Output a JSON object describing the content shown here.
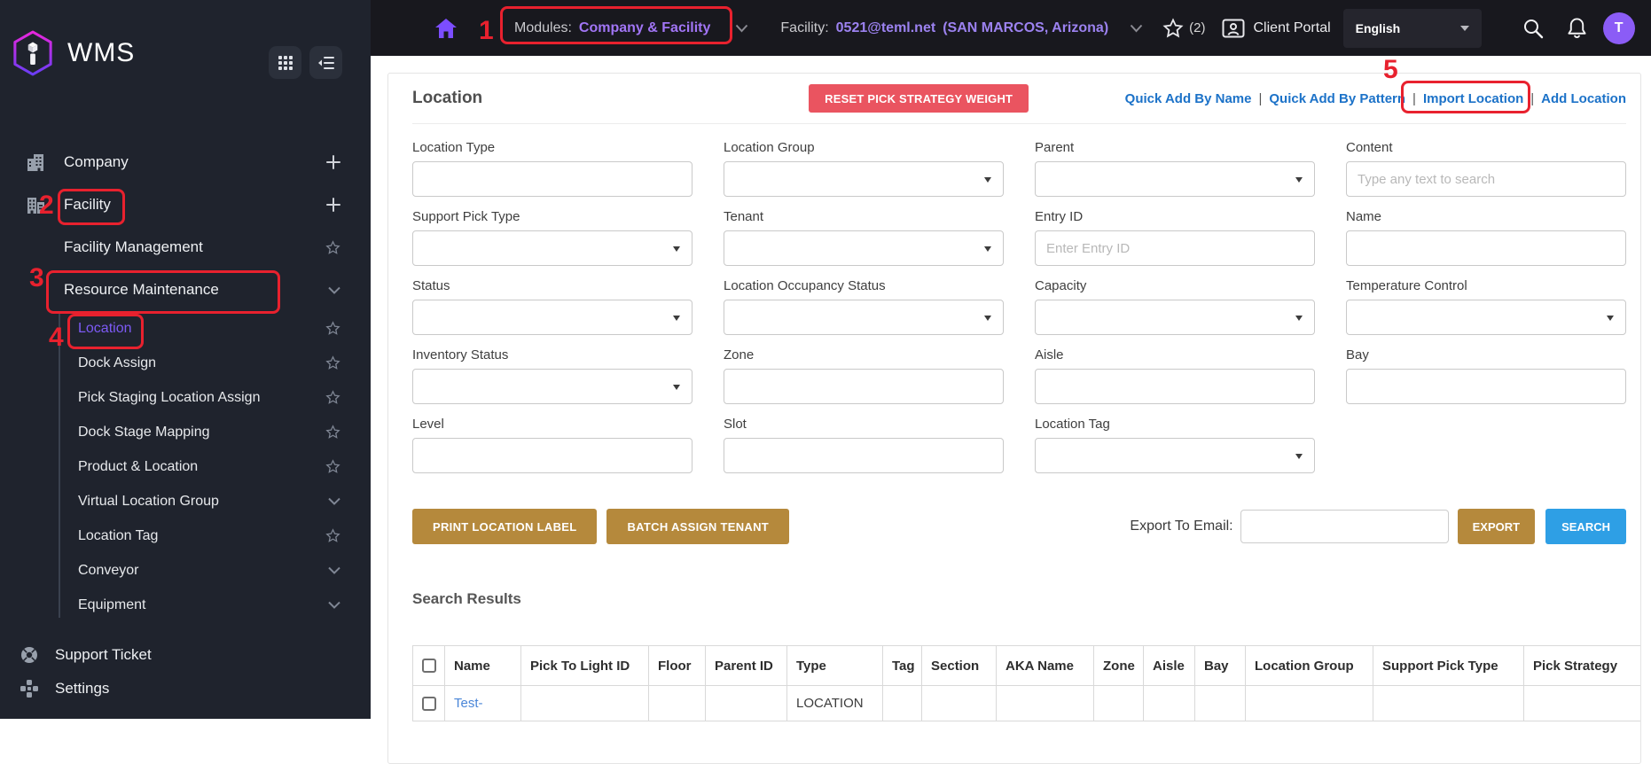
{
  "topbar": {
    "modules_label": "Modules:",
    "modules_value": "Company & Facility",
    "facility_label": "Facility:",
    "facility_value": "0521@teml.net",
    "facility_region": "(SAN MARCOS, Arizona)",
    "favorites_count": "(2)",
    "client_portal_label": "Client Portal",
    "language_value": "English",
    "avatar_initial": "T"
  },
  "sidebar": {
    "brand": "WMS",
    "items": [
      {
        "label": "Company"
      },
      {
        "label": "Facility"
      },
      {
        "label": "Facility Management"
      },
      {
        "label": "Resource Maintenance"
      }
    ],
    "submenu": [
      {
        "label": "Location"
      },
      {
        "label": "Dock Assign"
      },
      {
        "label": "Pick Staging Location Assign"
      },
      {
        "label": "Dock Stage Mapping"
      },
      {
        "label": "Product & Location"
      },
      {
        "label": "Virtual Location Group"
      },
      {
        "label": "Location Tag"
      },
      {
        "label": "Conveyor"
      },
      {
        "label": "Equipment"
      }
    ],
    "footer": [
      {
        "label": "Support Ticket"
      },
      {
        "label": "Settings"
      }
    ]
  },
  "page": {
    "title": "Location",
    "reset_button": "RESET PICK STRATEGY WEIGHT",
    "link_separator": "|",
    "links": [
      {
        "label": "Quick Add By Name"
      },
      {
        "label": "Quick Add By Pattern"
      },
      {
        "label": "Import Location"
      },
      {
        "label": "Add Location"
      }
    ]
  },
  "filters": {
    "fields": [
      {
        "label": "Location Type",
        "placeholder": ""
      },
      {
        "label": "Location Group"
      },
      {
        "label": "Parent"
      },
      {
        "label": "Content",
        "placeholder": "Type any text to search"
      },
      {
        "label": "Support Pick Type"
      },
      {
        "label": "Tenant"
      },
      {
        "label": "Entry ID",
        "placeholder": "Enter Entry ID"
      },
      {
        "label": "Name",
        "placeholder": ""
      },
      {
        "label": "Status"
      },
      {
        "label": "Location Occupancy Status"
      },
      {
        "label": "Capacity"
      },
      {
        "label": "Temperature Control"
      },
      {
        "label": "Inventory Status"
      },
      {
        "label": "Zone",
        "placeholder": ""
      },
      {
        "label": "Aisle",
        "placeholder": ""
      },
      {
        "label": "Bay",
        "placeholder": ""
      },
      {
        "label": "Level",
        "placeholder": ""
      },
      {
        "label": "Slot",
        "placeholder": ""
      },
      {
        "label": "Location Tag"
      }
    ]
  },
  "actions": {
    "print_button": "PRINT LOCATION LABEL",
    "batch_button": "BATCH ASSIGN TENANT",
    "export_label": "Export To Email:",
    "export_button": "EXPORT",
    "search_button": "SEARCH"
  },
  "results": {
    "heading": "Search Results",
    "columns": [
      "Name",
      "Pick To Light ID",
      "Floor",
      "Parent ID",
      "Type",
      "Tag",
      "Section",
      "AKA Name",
      "Zone",
      "Aisle",
      "Bay",
      "Location Group",
      "Support Pick Type",
      "Pick Strategy"
    ],
    "rows": [
      {
        "name": "Test-",
        "type": "LOCATION"
      }
    ]
  },
  "annotations": {
    "steps": [
      "1",
      "2",
      "3",
      "4",
      "5"
    ]
  },
  "colors": {
    "accent_purple": "#8b5cf6",
    "annotation_red": "#e8212e",
    "reset_red": "#ea5460",
    "gold": "#b5893c",
    "link_blue": "#1c72c8",
    "search_blue": "#2e9fe5",
    "active_menu_purple": "#7d5af5"
  }
}
